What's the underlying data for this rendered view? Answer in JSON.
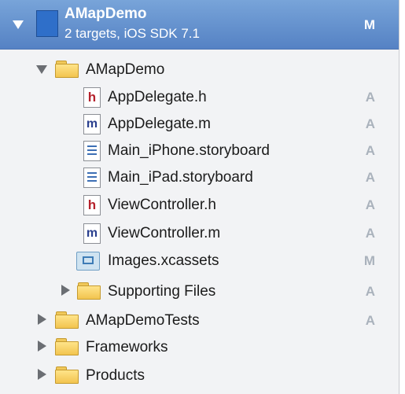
{
  "project": {
    "name": "AMapDemo",
    "subtitle": "2 targets, iOS SDK 7.1",
    "status": "M"
  },
  "items": [
    {
      "label": "AMapDemo",
      "status": ""
    },
    {
      "label": "AppDelegate.h",
      "status": "A"
    },
    {
      "label": "AppDelegate.m",
      "status": "A"
    },
    {
      "label": "Main_iPhone.storyboard",
      "status": "A"
    },
    {
      "label": "Main_iPad.storyboard",
      "status": "A"
    },
    {
      "label": "ViewController.h",
      "status": "A"
    },
    {
      "label": "ViewController.m",
      "status": "A"
    },
    {
      "label": "Images.xcassets",
      "status": "M"
    },
    {
      "label": "Supporting Files",
      "status": "A"
    },
    {
      "label": "AMapDemoTests",
      "status": "A"
    },
    {
      "label": "Frameworks",
      "status": ""
    },
    {
      "label": "Products",
      "status": ""
    }
  ],
  "icons": {
    "header_file": "h",
    "implementation_file": "m"
  },
  "colors": {
    "selection": "#5f8bd0",
    "status_text": "#aab2bc",
    "folder": "#f2c44f"
  }
}
